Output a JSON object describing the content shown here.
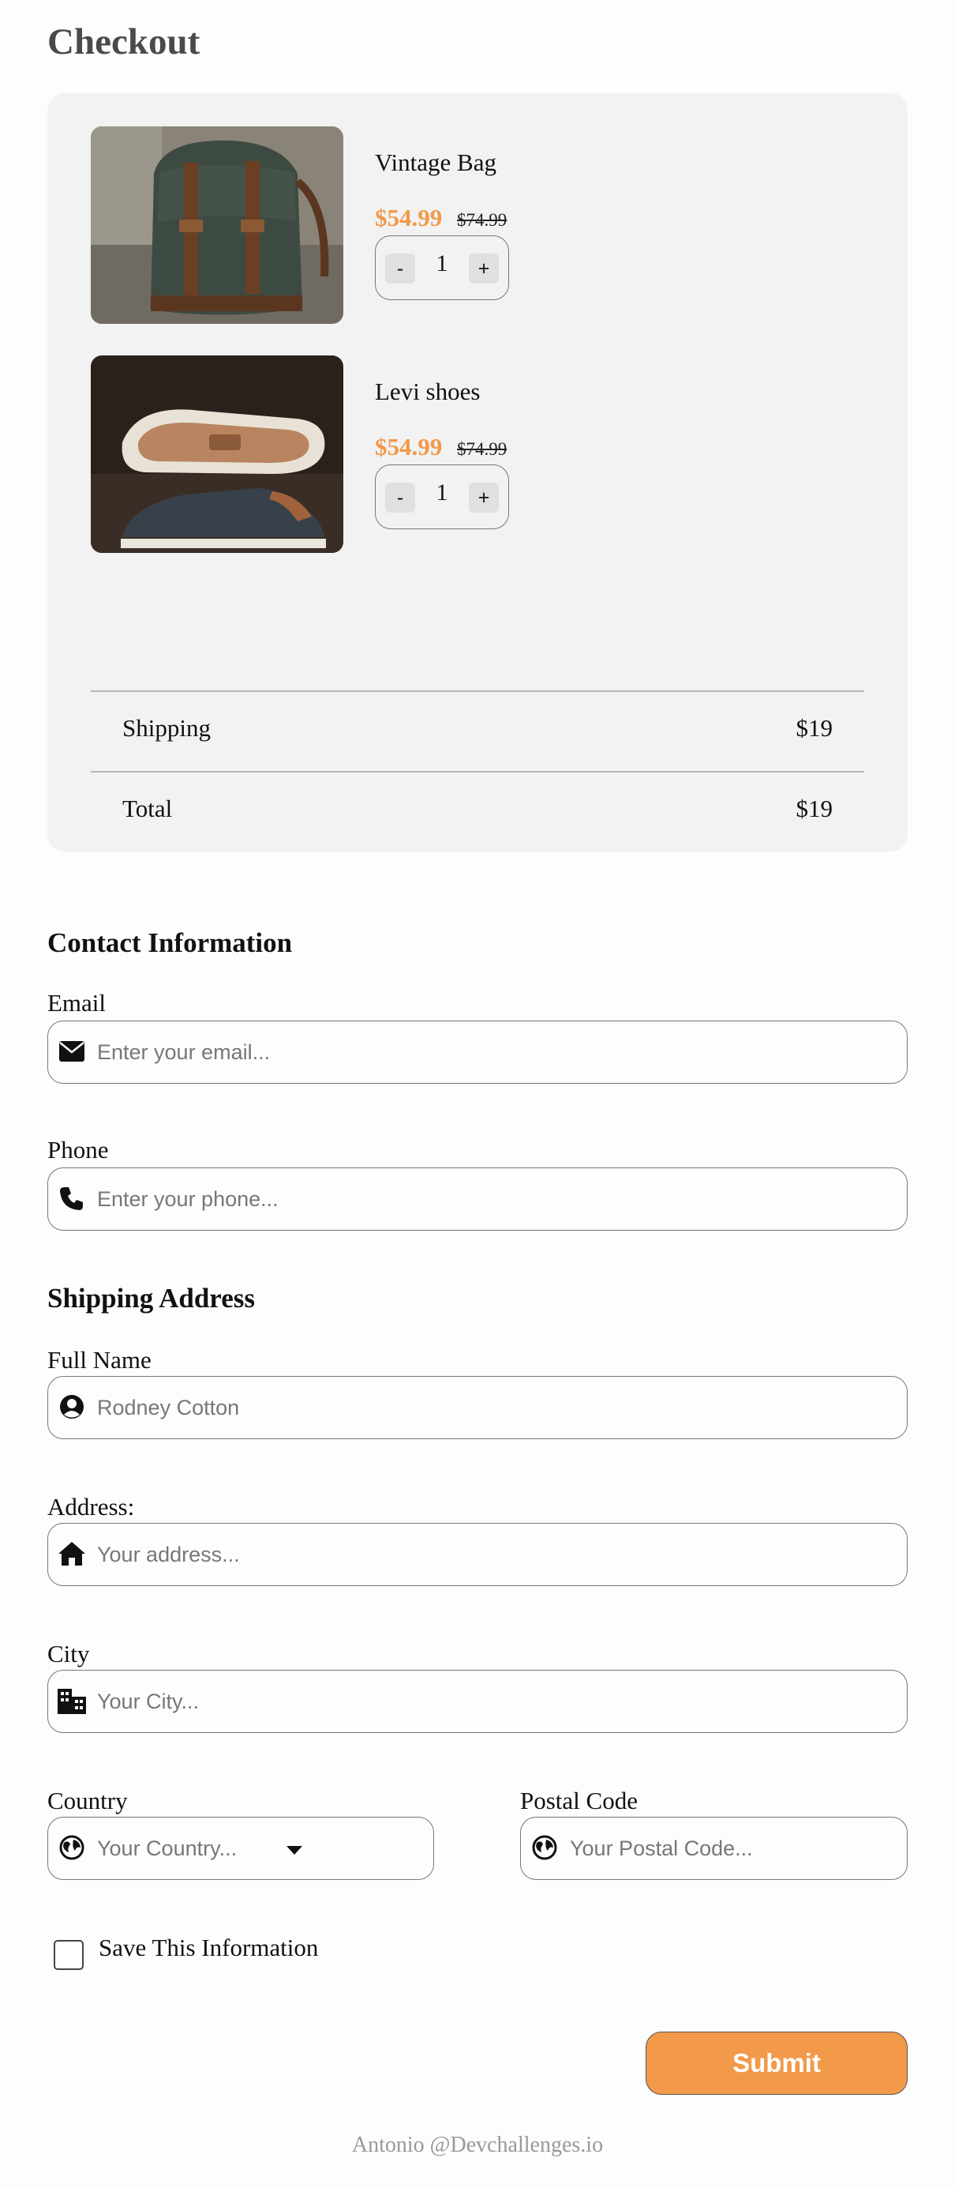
{
  "page": {
    "title": "Checkout"
  },
  "cart": {
    "items": [
      {
        "name": "Vintage Bag",
        "price": "$54.99",
        "old_price": "$74.99",
        "quantity": "1",
        "minus_label": "-",
        "plus_label": "+"
      },
      {
        "name": "Levi shoes",
        "price": "$54.99",
        "old_price": "$74.99",
        "quantity": "1",
        "minus_label": "-",
        "plus_label": "+"
      }
    ],
    "summary": [
      {
        "label": "Shipping",
        "value": "$19"
      },
      {
        "label": "Total",
        "value": "$19"
      }
    ]
  },
  "contact": {
    "heading": "Contact Information",
    "email": {
      "label": "Email",
      "placeholder": "Enter your email...",
      "value": "",
      "icon": "envelope-icon"
    },
    "phone": {
      "label": "Phone",
      "placeholder": "Enter your phone...",
      "value": "",
      "icon": "phone-icon"
    }
  },
  "shipping": {
    "heading": "Shipping Address",
    "full_name": {
      "label": "Full Name",
      "placeholder": "Rodney Cotton",
      "value": "",
      "icon": "user-circle-icon"
    },
    "address": {
      "label": "Address:",
      "placeholder": "Your address...",
      "value": "",
      "icon": "home-icon"
    },
    "city": {
      "label": "City",
      "placeholder": "Your City...",
      "value": "",
      "icon": "city-icon"
    },
    "country": {
      "label": "Country",
      "placeholder": "Your Country...",
      "value": "",
      "icon": "globe-icon"
    },
    "postal_code": {
      "label": "Postal Code",
      "placeholder": "Your Postal Code...",
      "value": "",
      "icon": "globe-icon"
    }
  },
  "save_info": {
    "label": "Save This Information",
    "checked": false
  },
  "submit": {
    "label": "Submit"
  },
  "footer": {
    "text": "Antonio @Devchallenges.io"
  },
  "colors": {
    "accent": "#f2994a",
    "card_bg": "#f2f2f2",
    "border": "#777777",
    "title": "#4a4a4a"
  }
}
